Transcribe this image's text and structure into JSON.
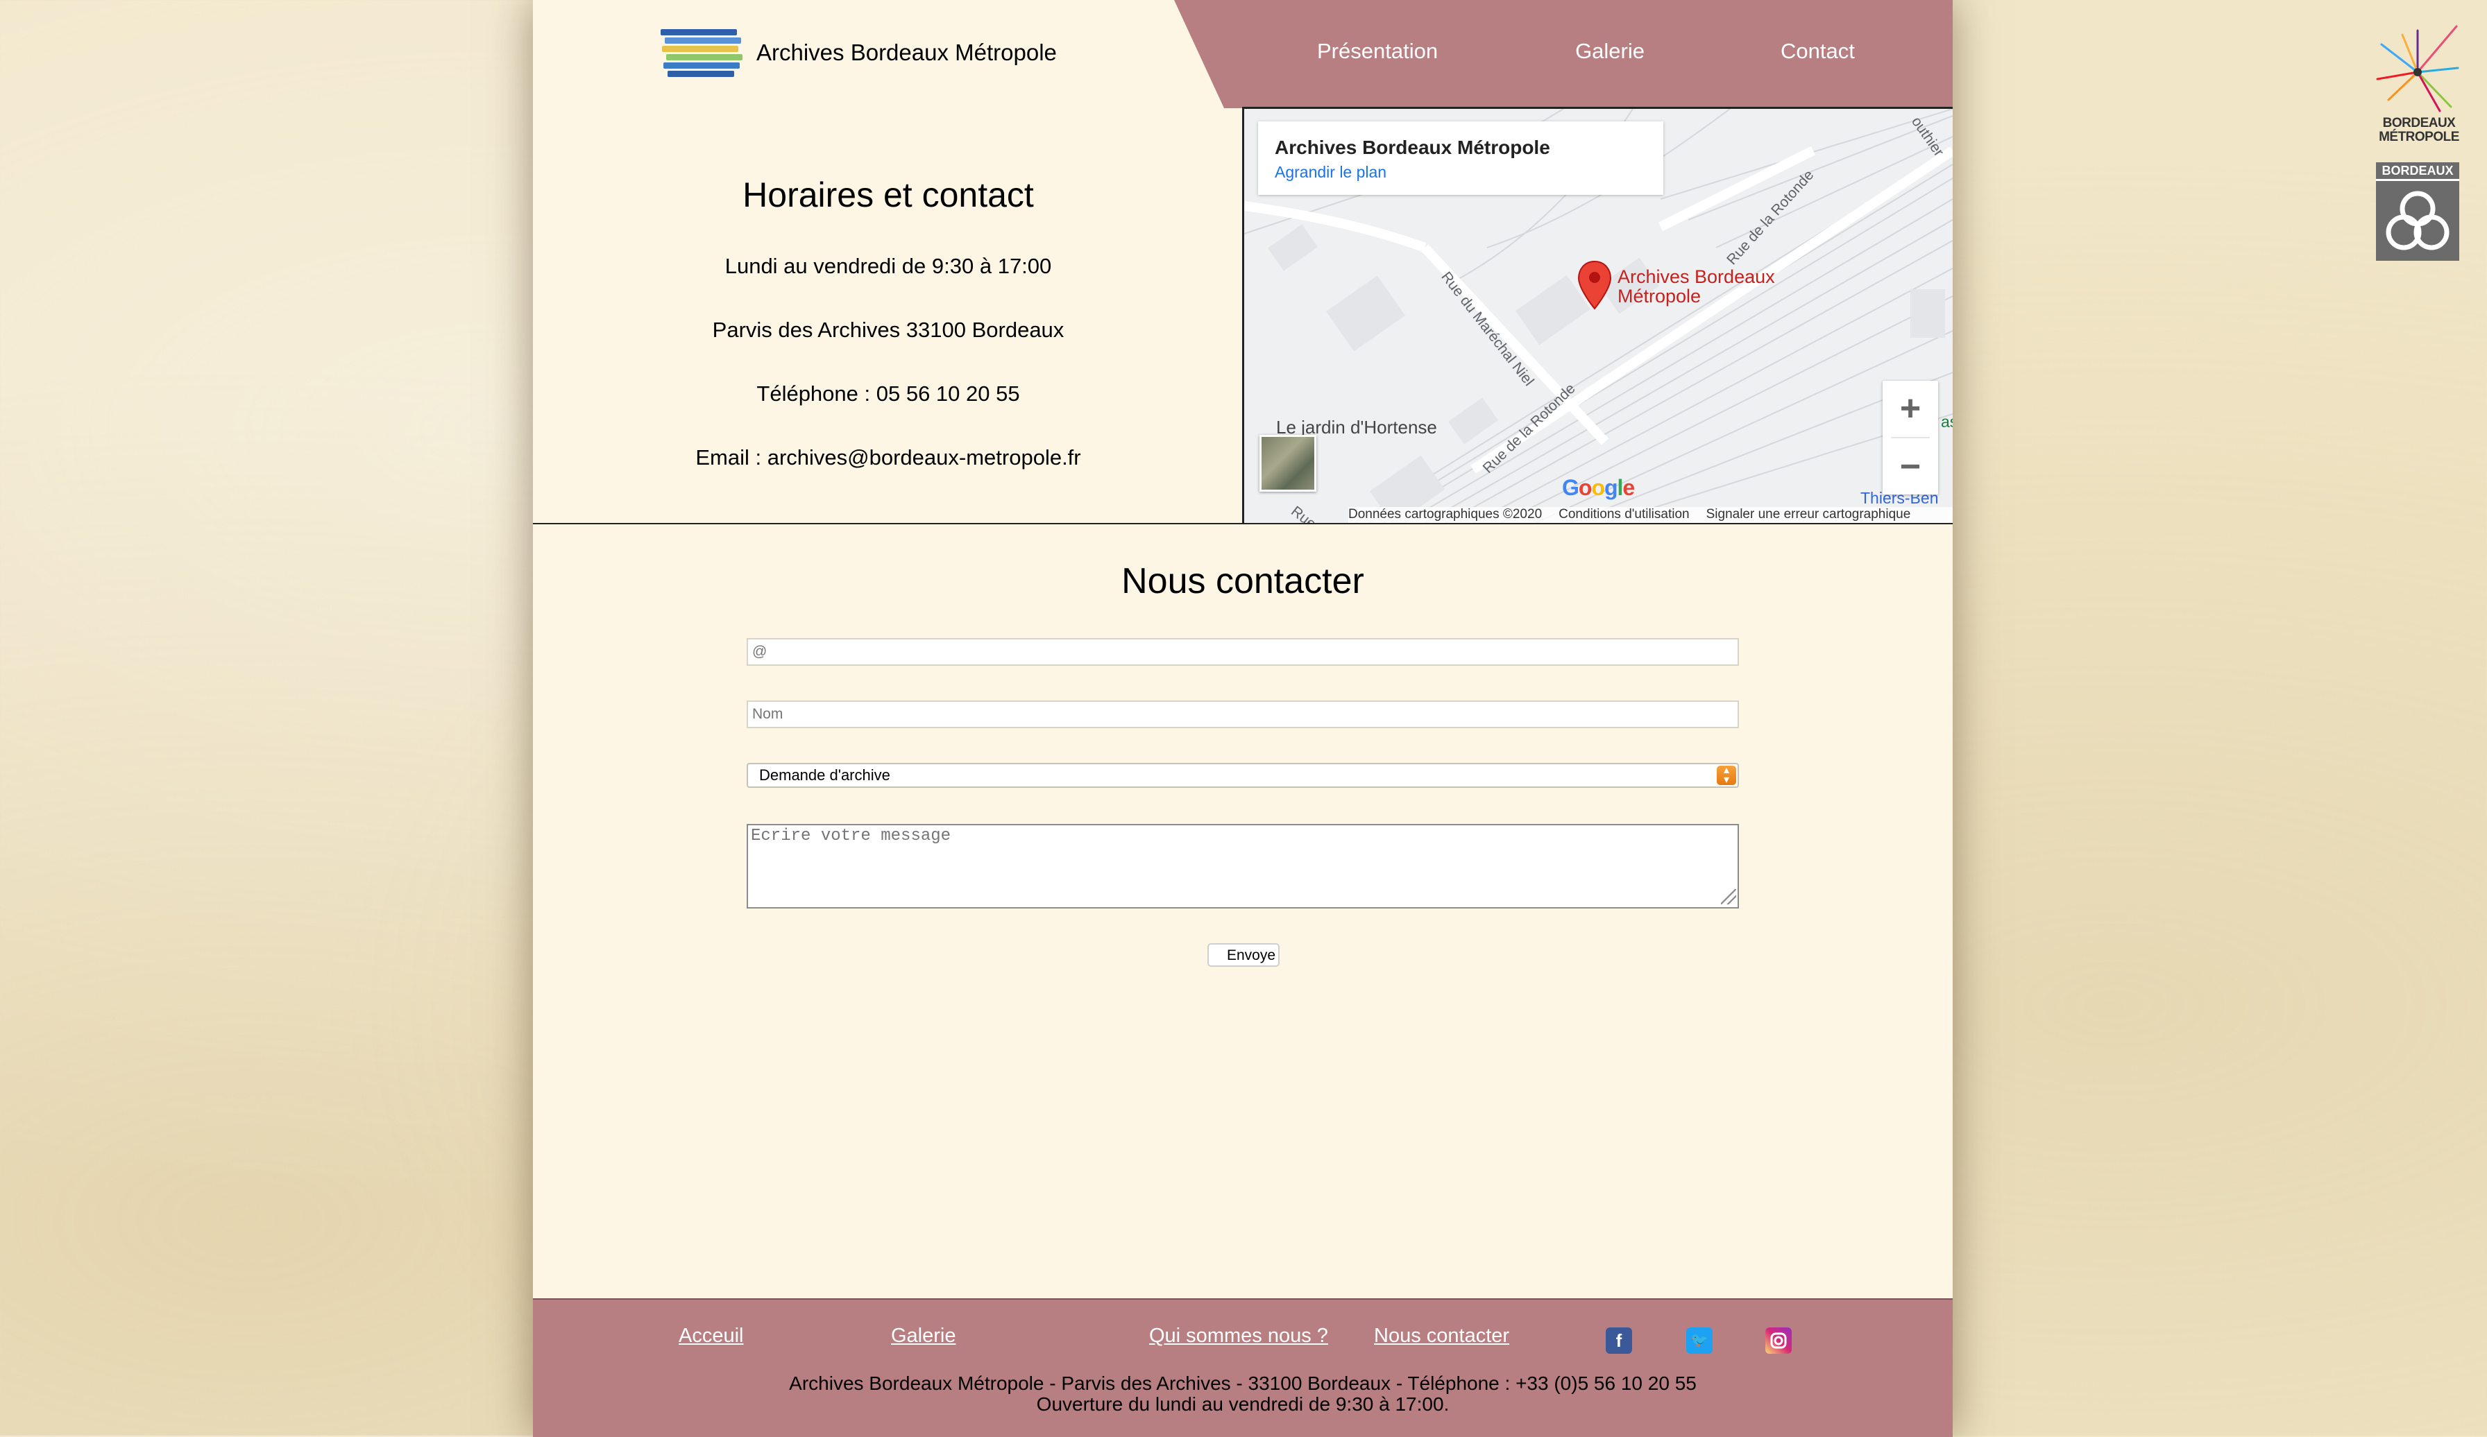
{
  "header": {
    "brand_title": "Archives Bordeaux Métropole",
    "nav": [
      "Présentation",
      "Galerie",
      "Contact"
    ],
    "nav_color": "#b77f82",
    "logo_colors": [
      "#2e5fa8",
      "#5a92d6",
      "#e8c34b",
      "#8fc76a",
      "#3b7cc4"
    ]
  },
  "info": {
    "title": "Horaires et contact",
    "hours": "Lundi au vendredi de 9:30 à 17:00",
    "address": "Parvis des Archives 33100 Bordeaux",
    "phone": "Téléphone : 05 56 10 20 55",
    "email": "Email : archives@bordeaux-metropole.fr"
  },
  "map": {
    "card_title": "Archives Bordeaux Métropole",
    "card_link": "Agrandir le plan",
    "marker_label_1": "Archives Bordeaux",
    "marker_label_2": "Métropole",
    "streets": {
      "s1": "Rue du Maréchal Niel",
      "s2": "Rue de la Rotonde",
      "s3": "Rue de la Rotonde",
      "s4": "Rue Ho",
      "s5": "outhier",
      "s6": "Thiers-Ben",
      "s7": "as"
    },
    "place": "Le jardin d'Hortense",
    "google": "Google",
    "zoom_in": "+",
    "zoom_out": "−",
    "footer": [
      "Données cartographiques ©2020",
      "Conditions d'utilisation",
      "Signaler une erreur cartographique"
    ]
  },
  "contact": {
    "title": "Nous contacter",
    "email_placeholder": "@",
    "name_placeholder": "Nom",
    "subject_selected": "Demande d'archive",
    "message_placeholder": "Ecrire votre message",
    "send_label": "Envoye"
  },
  "footer": {
    "links": [
      "Acceuil",
      "Galerie",
      "Qui sommes nous ?",
      "Nous contacter"
    ],
    "social": [
      "facebook-icon",
      "twitter-icon",
      "instagram-icon"
    ],
    "line1": "Archives Bordeaux Métropole - Parvis des Archives - 33100 Bordeaux - Téléphone : +33 (0)5 56 10 20 55",
    "line2": "Ouverture du lundi au vendredi de 9:30 à 17:00."
  },
  "side_logos": {
    "bm_line1": "BORDEAUX",
    "bm_line2": "MÉTROPOLE",
    "bx_label": "BORDEAUX"
  }
}
